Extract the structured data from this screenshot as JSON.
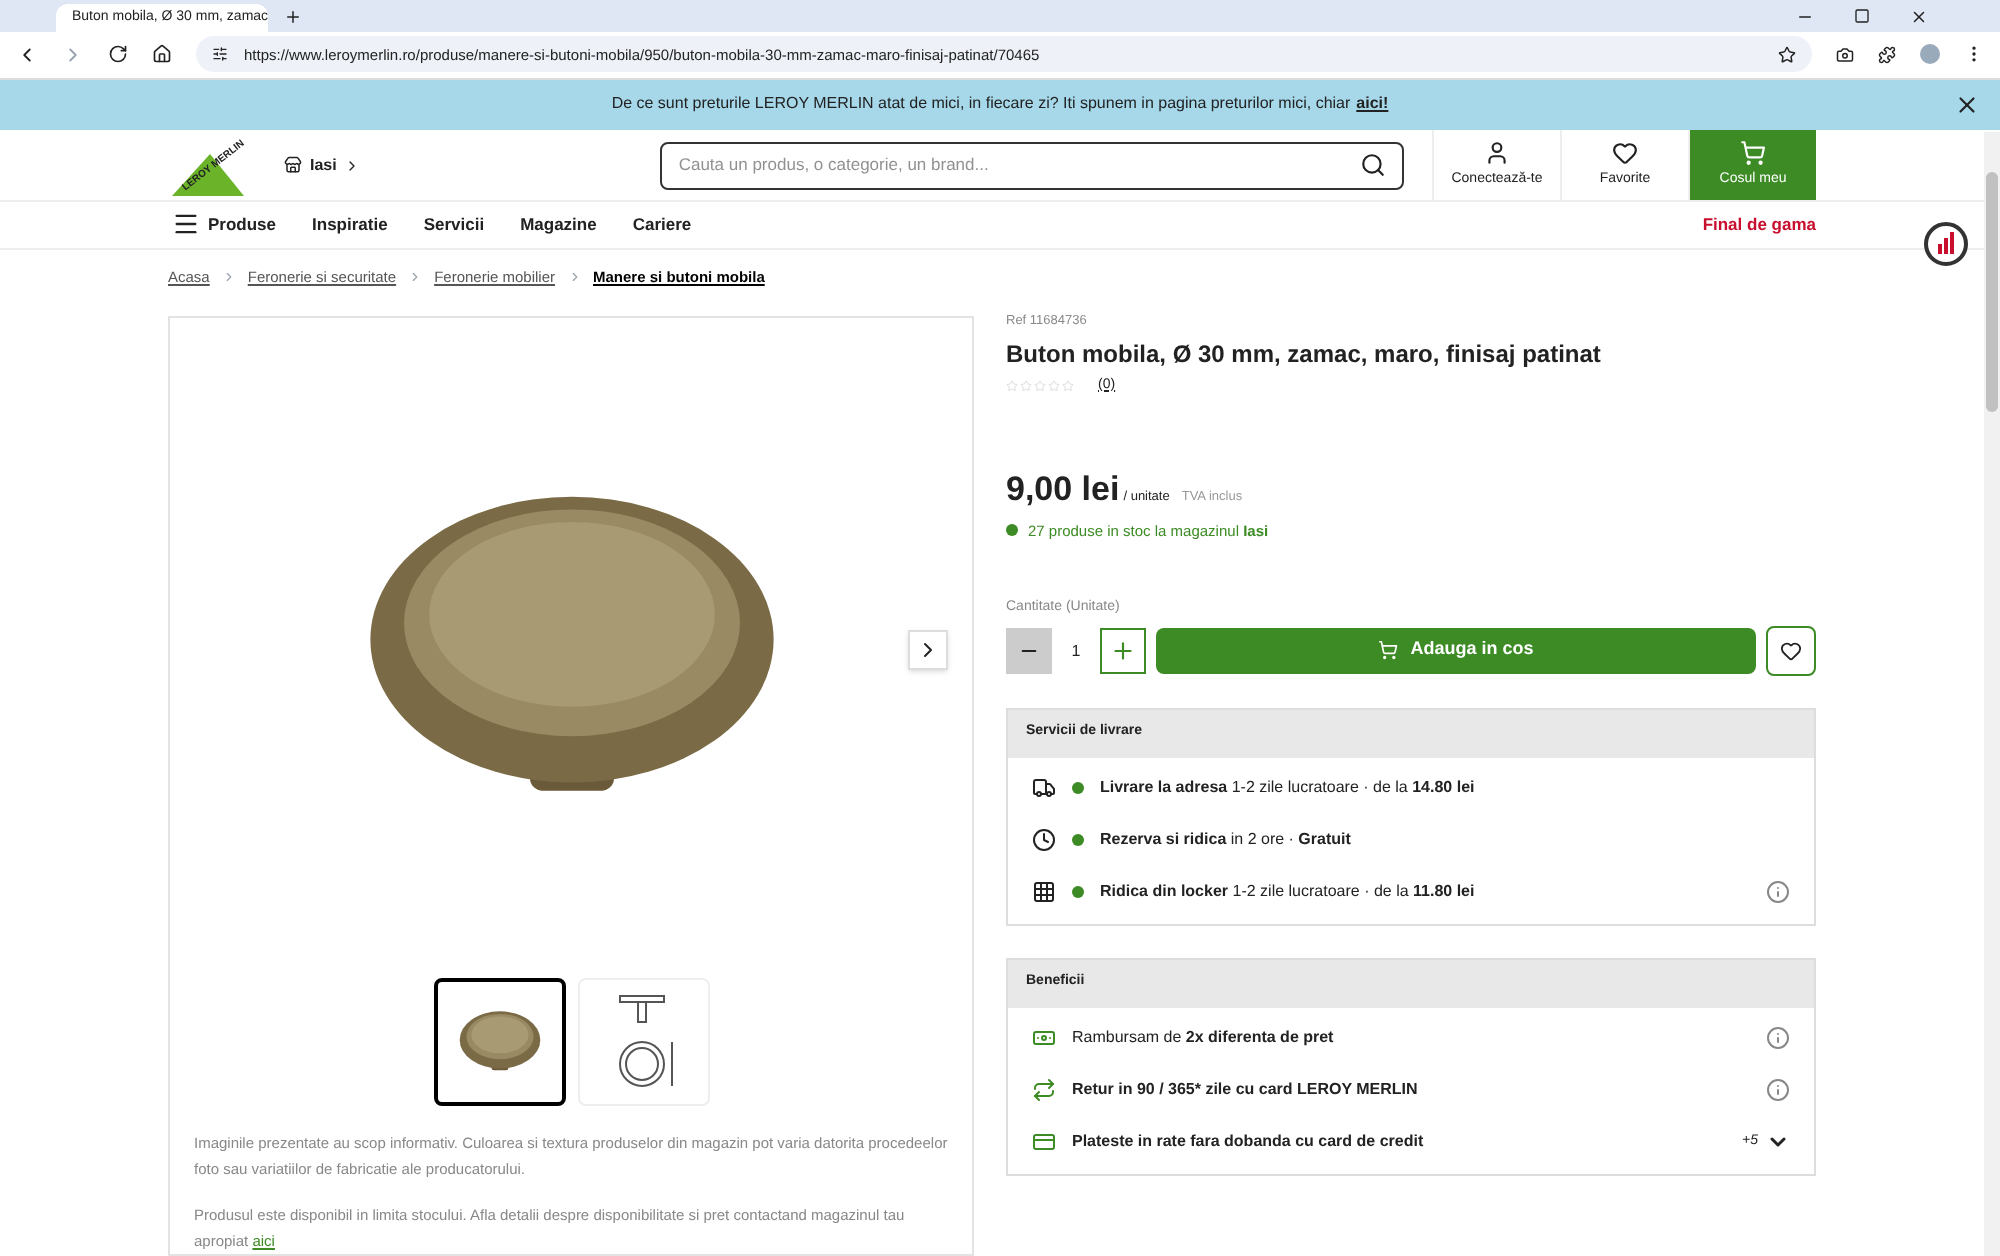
{
  "browser": {
    "tab_title": "Buton mobila, Ø 30 mm, zamac",
    "url": "https://www.leroymerlin.ro/produse/manere-si-butoni-mobila/950/buton-mobila-30-mm-zamac-maro-finisaj-patinat/70465"
  },
  "banner": {
    "text": "De ce sunt preturile LEROY MERLIN atat de mici, in fiecare zi? Iti spunem in pagina preturilor mici, chiar",
    "link": "aici!"
  },
  "header": {
    "logo": "LEROY MERLIN",
    "store": "Iasi",
    "search_placeholder": "Cauta un produs, o categorie, un brand...",
    "actions": [
      {
        "label": "Conectează-te",
        "kind": "user"
      },
      {
        "label": "Favorite",
        "kind": "heart"
      },
      {
        "label": "Cosul meu",
        "kind": "cart"
      }
    ]
  },
  "nav": {
    "menu": "Produse",
    "items": [
      "Inspiratie",
      "Servicii",
      "Magazine",
      "Cariere"
    ],
    "promo": "Final de gama"
  },
  "breadcrumb": [
    {
      "label": "Acasa",
      "current": false
    },
    {
      "label": "Feronerie si securitate",
      "current": false
    },
    {
      "label": "Feronerie mobilier",
      "current": false
    },
    {
      "label": "Manere si butoni mobila",
      "current": true
    }
  ],
  "gallery": {
    "thumbnails": [
      {
        "kind": "photo",
        "selected": true
      },
      {
        "kind": "diagram",
        "selected": false
      }
    ],
    "notes": [
      "Imaginile prezentate au scop informativ. Culoarea si textura produselor din magazin pot varia datorita procedeelor foto sau variatiilor de fabricatie ale producatorului.",
      "Produsul este disponibil in limita stocului. Afla detalii despre disponibilitate si pret contactand magazinul tau apropiat"
    ],
    "notes_link": "aici"
  },
  "product": {
    "ref": "Ref 11684736",
    "title": "Buton mobila, Ø 30 mm, zamac, maro, finisaj patinat",
    "stars": 0,
    "reviews": "(0)",
    "price": "9,00 lei",
    "unit": "/ unitate",
    "vat": "TVA inclus",
    "stock": "27 produse in stoc la magazinul **Iasi**",
    "quantity_label": "Cantitate (Unitate)",
    "quantity": "1",
    "add_button": "Adauga in cos"
  },
  "delivery": {
    "title": "Servicii de livrare",
    "rows": [
      {
        "kind": "truck",
        "text": "**Livrare la adresa** 1-2 zile lucratoare · de la **14.80 lei**",
        "info": false
      },
      {
        "kind": "clock",
        "text": "**Rezerva si ridica** in 2 ore · **Gratuit**",
        "info": false
      },
      {
        "kind": "locker",
        "text": "**Ridica din locker** 1-2 zile lucratoare · de la **11.80 lei**",
        "info": true
      }
    ]
  },
  "benefits": {
    "title": "Beneficii",
    "rows": [
      {
        "kind": "cash",
        "text": "Rambursam de **2x diferenta de pret**",
        "info": true
      },
      {
        "kind": "return",
        "text": "**Retur in 90 / 365* zile cu card LEROY MERLIN**",
        "info": true
      },
      {
        "kind": "card",
        "text": "**Plateste in rate fara dobanda cu card de credit**",
        "info": false
      }
    ],
    "more": "+5"
  }
}
